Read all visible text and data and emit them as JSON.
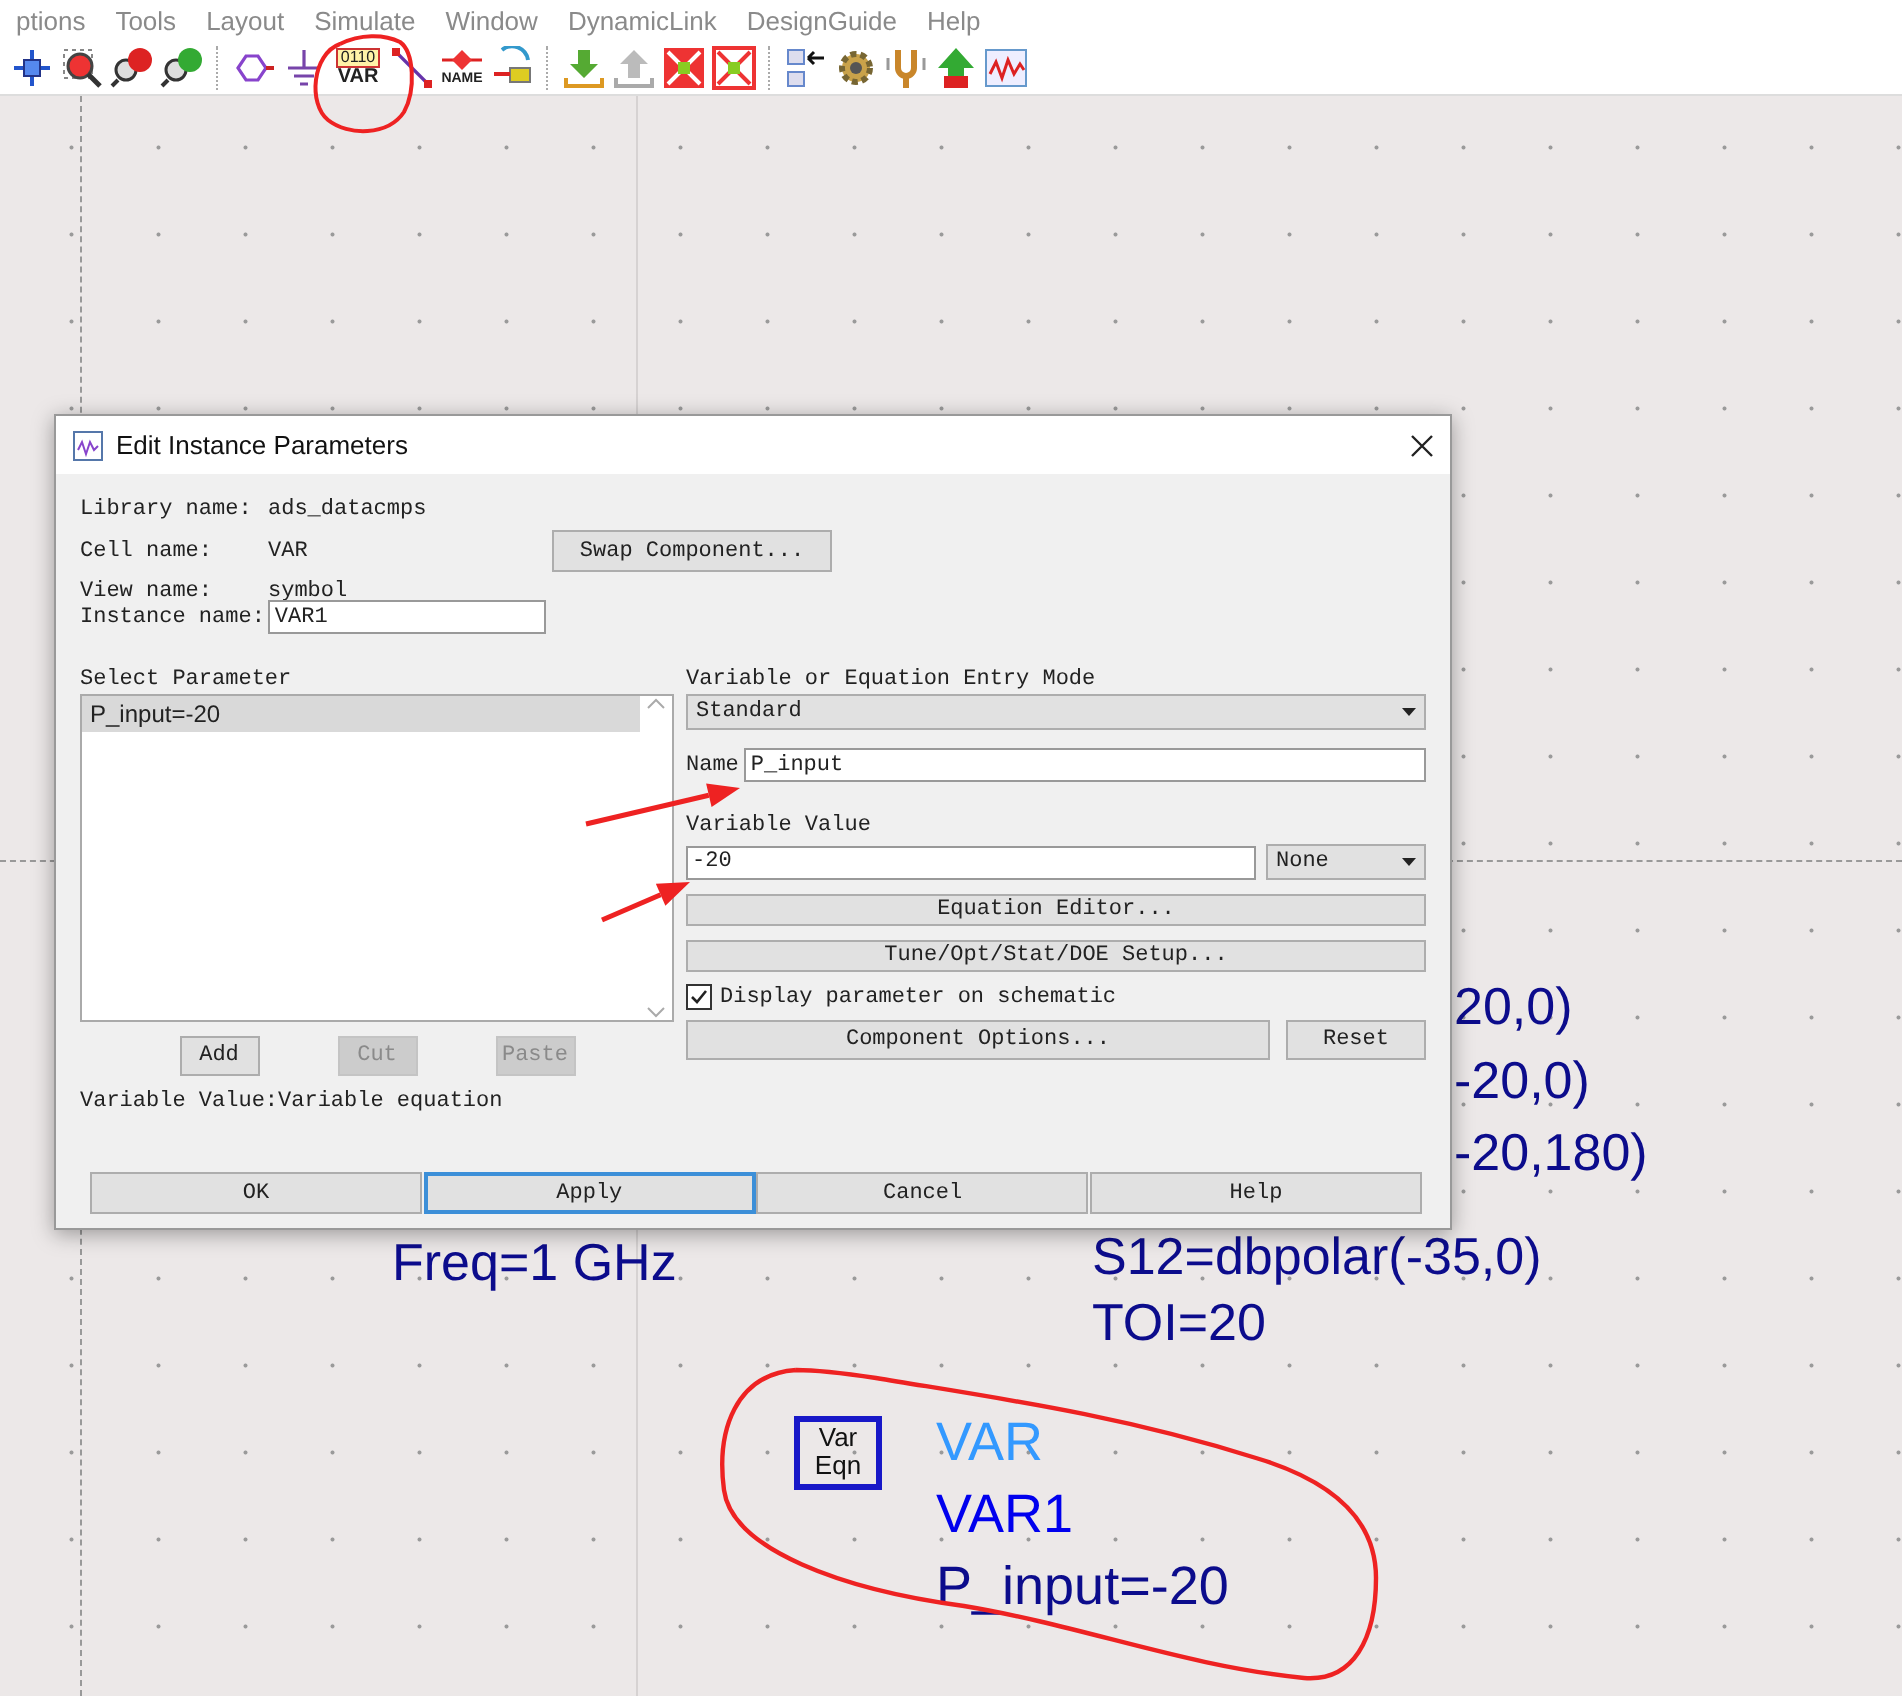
{
  "menu_bar": {
    "items": [
      {
        "label": "ptions"
      },
      {
        "label": "Tools"
      },
      {
        "label": "Layout"
      },
      {
        "label": "Simulate"
      },
      {
        "label": "Window"
      },
      {
        "label": "DynamicLink"
      },
      {
        "label": "DesignGuide"
      },
      {
        "label": "Help"
      }
    ]
  },
  "toolbar": {
    "groups": [
      [
        {
          "kind": "move"
        },
        {
          "kind": "zoom_area"
        },
        {
          "kind": "zoom_in"
        },
        {
          "kind": "zoom_out"
        }
      ],
      [
        {
          "kind": "port"
        },
        {
          "kind": "ground"
        },
        {
          "kind": "var",
          "code": "0110",
          "label": "VAR"
        },
        {
          "kind": "wire"
        },
        {
          "kind": "name",
          "label": "NAME"
        },
        {
          "kind": "pin"
        }
      ],
      [
        {
          "kind": "push_down"
        },
        {
          "kind": "pop_up"
        },
        {
          "kind": "deactivate"
        },
        {
          "kind": "short"
        }
      ],
      [
        {
          "kind": "link"
        },
        {
          "kind": "gear"
        },
        {
          "kind": "tune"
        },
        {
          "kind": "arrow_up"
        },
        {
          "kind": "graph"
        }
      ]
    ]
  },
  "schematic": {
    "labels": [
      {
        "text": "20,0)"
      },
      {
        "text": "-20,0)"
      },
      {
        "text": "-20,180)"
      },
      {
        "text": "Freq=1 GHz"
      },
      {
        "text": "S12=dbpolar(-35,0)"
      },
      {
        "text": "TOI=20"
      }
    ],
    "var_block": {
      "symbol_lines": [
        "Var",
        "Eqn"
      ],
      "type": "VAR",
      "instance": "VAR1",
      "parameter": "P_input=-20"
    }
  },
  "dialog": {
    "title": "Edit Instance Parameters",
    "info": [
      {
        "label": "Library name:",
        "value": "ads_datacmps"
      },
      {
        "label": "Cell name:",
        "value": "VAR"
      },
      {
        "label": "View name:",
        "value": "symbol"
      }
    ],
    "swap_button": "Swap Component...",
    "instance_name": {
      "label": "Instance name:",
      "value": "VAR1"
    },
    "select_parameter": {
      "label": "Select Parameter",
      "items": [
        {
          "text": "P_input=-20",
          "selected": true
        }
      ]
    },
    "list_buttons": [
      {
        "label": "Add",
        "disabled": false
      },
      {
        "label": "Cut",
        "disabled": true
      },
      {
        "label": "Paste",
        "disabled": true
      }
    ],
    "hint": "Variable Value:Variable equation",
    "entry_mode": {
      "label": "Variable or Equation Entry Mode",
      "value": "Standard"
    },
    "name": {
      "label": "Name",
      "value": "P_input"
    },
    "variable_value": {
      "label": "Variable Value",
      "value": "-20",
      "unit": "None"
    },
    "equation_editor_button": "Equation Editor...",
    "tune_button": "Tune/Opt/Stat/DOE Setup...",
    "display_checkbox": {
      "label": "Display parameter on schematic",
      "checked": true
    },
    "component_options_button": "Component Options...",
    "reset_button": "Reset",
    "footer_buttons": [
      {
        "label": "OK",
        "focused": false
      },
      {
        "label": "Apply",
        "focused": true
      },
      {
        "label": "Cancel",
        "focused": false
      },
      {
        "label": "Help",
        "focused": false
      }
    ]
  },
  "annotations": [
    {
      "kind": "circle"
    },
    {
      "kind": "ellipse"
    },
    {
      "kind": "arrow"
    },
    {
      "kind": "arrow"
    }
  ]
}
